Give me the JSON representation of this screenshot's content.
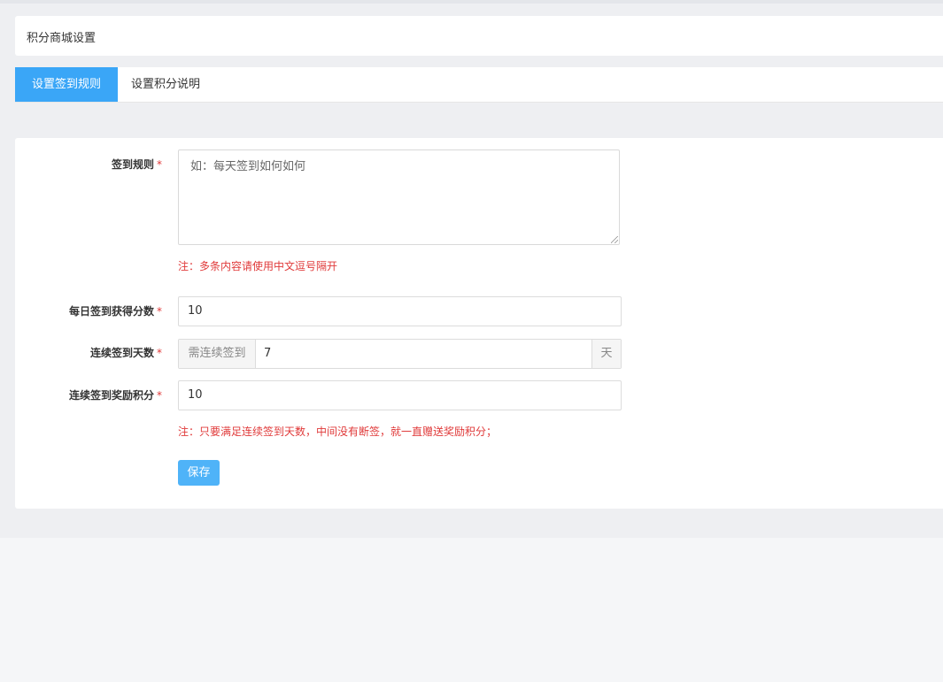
{
  "page": {
    "title": "积分商城设置"
  },
  "tabs": [
    {
      "label": "设置签到规则",
      "active": true
    },
    {
      "label": "设置积分说明",
      "active": false
    }
  ],
  "form": {
    "required_mark": "*",
    "sign_rule": {
      "label": "签到规则",
      "placeholder": "如：每天签到如何如何",
      "note": "注：多条内容请使用中文逗号隔开"
    },
    "daily_points": {
      "label": "每日签到获得分数",
      "value": "10"
    },
    "consecutive_days": {
      "label": "连续签到天数",
      "prefix": "需连续签到",
      "value": "7",
      "suffix": "天"
    },
    "consecutive_reward": {
      "label": "连续签到奖励积分",
      "value": "10",
      "note": "注：只要满足连续签到天数，中间没有断签，就一直赠送奖励积分；"
    },
    "save_label": "保存"
  },
  "colors": {
    "accent": "#3aa6f7",
    "button": "#4fb3f8",
    "required": "#e03a3a"
  }
}
